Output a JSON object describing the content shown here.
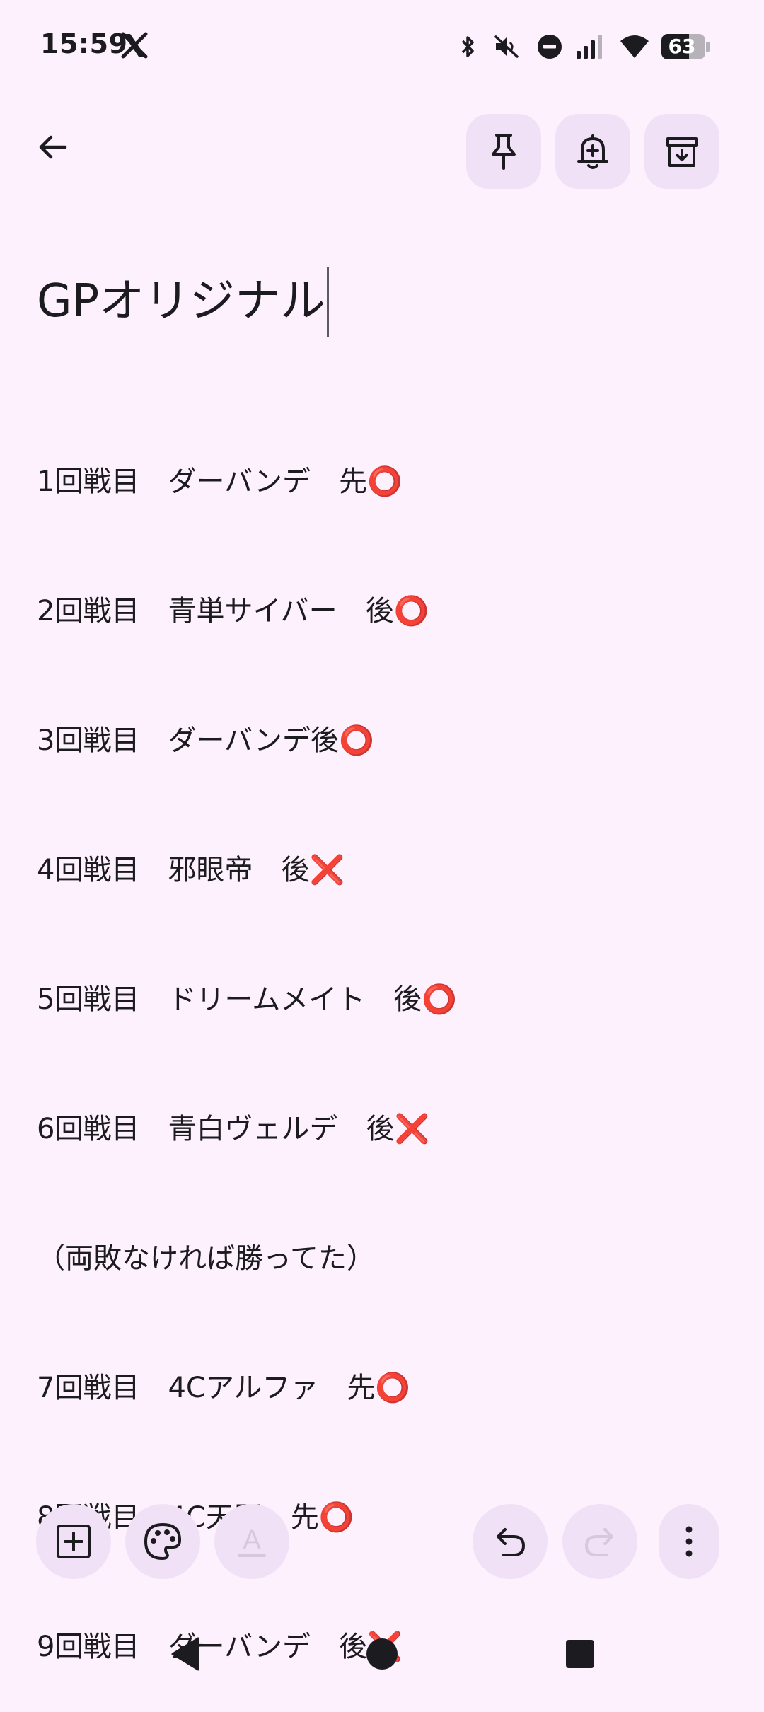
{
  "status_bar": {
    "time": "15:59",
    "battery_level": "63",
    "icons": [
      "x-app-icon",
      "bluetooth-icon",
      "mute-icon",
      "do-not-disturb-icon",
      "signal-icon",
      "wifi-icon",
      "battery-icon"
    ]
  },
  "toolbar_icons": {
    "back": "arrow-back-icon",
    "pin": "pin-icon",
    "reminder": "bell-plus-icon",
    "archive": "archive-icon"
  },
  "note": {
    "title": "GPオリジナル",
    "lines": [
      "1回戦目　ダーバンデ　先⭕",
      "2回戦目　青単サイバー　後⭕",
      "3回戦目　ダーバンデ後⭕",
      "4回戦目　邪眼帝　後❌",
      "5回戦目　ドリームメイト　後⭕",
      "6回戦目　青白ヴェルデ　後❌",
      "（両敗なければ勝ってた）",
      "7回戦目　4Cアルファ　先⭕",
      "8回戦目　4C天門　先⭕",
      "9回戦目　ダーバンデ　後❌"
    ]
  },
  "bottom_bar": {
    "format_label": "A",
    "icons": [
      "add-box-icon",
      "palette-icon",
      "text-format-icon",
      "undo-icon",
      "redo-icon",
      "more-vert-icon"
    ]
  },
  "colors": {
    "background": "#fdf1fd",
    "button_container": "#f1e1f6",
    "text": "#1c1b1f",
    "disabled": "#d8c8dc"
  }
}
